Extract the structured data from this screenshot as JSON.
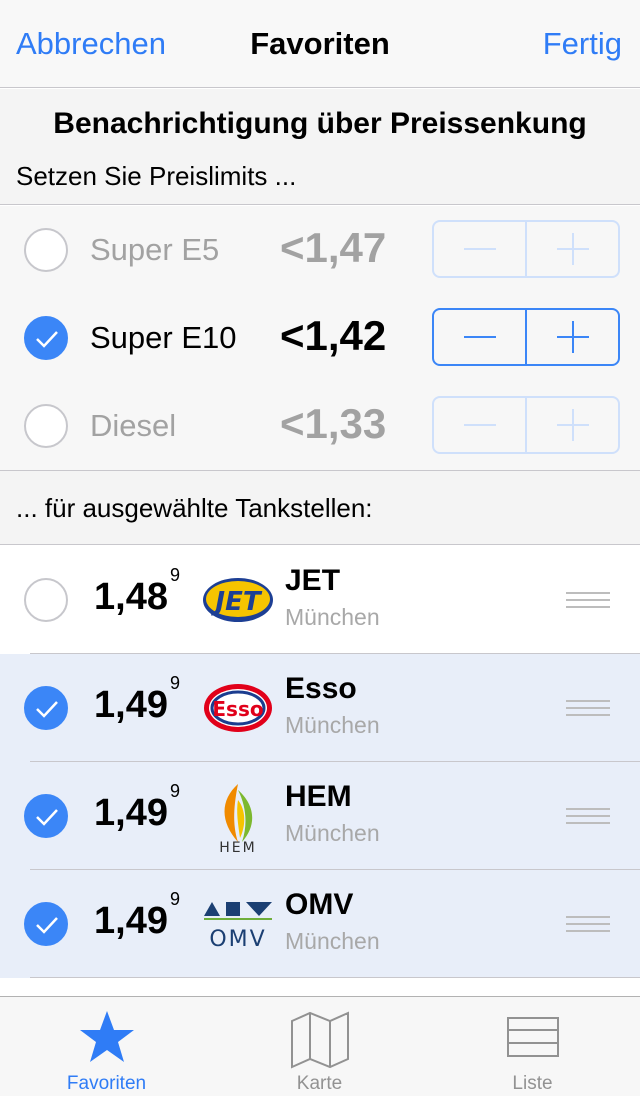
{
  "navbar": {
    "cancel": "Abbrechen",
    "title": "Favoriten",
    "done": "Fertig"
  },
  "notify": {
    "title": "Benachrichtigung über Preissenkung",
    "subtitle": "Setzen Sie Preislimits ...",
    "fuels": [
      {
        "name": "Super E5",
        "limit": "<1,47",
        "checked": false
      },
      {
        "name": "Super E10",
        "limit": "<1,42",
        "checked": true
      },
      {
        "name": "Diesel",
        "limit": "<1,33",
        "checked": false
      }
    ]
  },
  "stations_header": "... für ausgewählte Tankstellen:",
  "stations": [
    {
      "price": "1,48",
      "price_sup": "9",
      "brand": "JET",
      "city": "München",
      "selected": false
    },
    {
      "price": "1,49",
      "price_sup": "9",
      "brand": "Esso",
      "city": "München",
      "selected": true
    },
    {
      "price": "1,49",
      "price_sup": "9",
      "brand": "HEM",
      "city": "München",
      "selected": true,
      "logo_text": "HEM"
    },
    {
      "price": "1,49",
      "price_sup": "9",
      "brand": "OMV",
      "city": "München",
      "selected": true,
      "logo_text": "OMV"
    }
  ],
  "logo_text": {
    "jet": "JET",
    "esso": "Esso",
    "hem": "HEM",
    "omv": "OMV"
  },
  "tabs": [
    {
      "label": "Favoriten",
      "icon": "star-icon",
      "active": true
    },
    {
      "label": "Karte",
      "icon": "map-icon",
      "active": false
    },
    {
      "label": "Liste",
      "icon": "list-icon",
      "active": false
    }
  ],
  "colors": {
    "accent": "#2f7cf6",
    "selected_row": "#e8eef9"
  }
}
